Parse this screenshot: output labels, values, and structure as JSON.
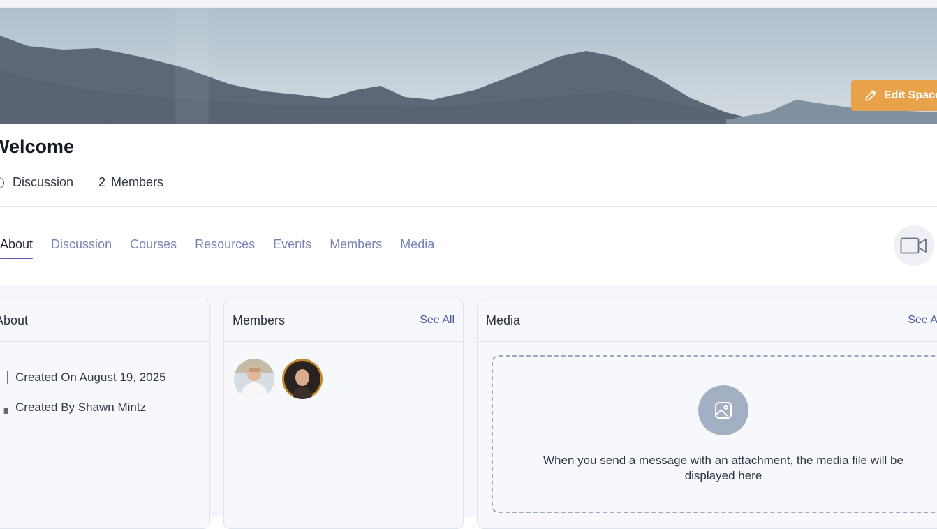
{
  "header": {
    "edit_label": "Edit Space"
  },
  "space": {
    "title": "Welcome",
    "discussion_label": "Discussion",
    "members_count": "2",
    "members_label": "Members"
  },
  "tabs": [
    {
      "label": "About",
      "active": true
    },
    {
      "label": "Discussion"
    },
    {
      "label": "Courses"
    },
    {
      "label": "Resources"
    },
    {
      "label": "Events"
    },
    {
      "label": "Members"
    },
    {
      "label": "Media"
    }
  ],
  "about": {
    "title": "About",
    "created_on": "Created On August 19, 2025",
    "created_by": "Created By Shawn Mintz"
  },
  "members": {
    "title": "Members",
    "see_all": "See All"
  },
  "media": {
    "title": "Media",
    "see_all": "See All",
    "empty_message": "When you send a message with an attachment, the media file will be displayed here"
  },
  "icons": {
    "edit": "pencil-icon",
    "video": "video-camera-icon",
    "media": "image-icon",
    "calendar": "calendar-icon",
    "user": "user-icon"
  },
  "colors": {
    "accent": "#e8a24a",
    "tab_inactive": "#7b84b8",
    "tab_active_underline": "#5a55b8",
    "link": "#4a5aa8"
  }
}
